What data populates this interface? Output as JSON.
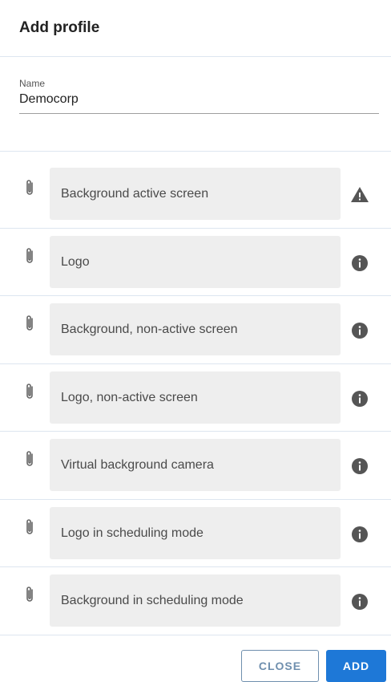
{
  "dialog": {
    "title": "Add profile"
  },
  "name_field": {
    "label": "Name",
    "value": "Democorp"
  },
  "uploads": [
    {
      "label": "Background active screen",
      "status_icon": "warning-icon"
    },
    {
      "label": "Logo",
      "status_icon": "info-icon"
    },
    {
      "label": "Background, non-active screen",
      "status_icon": "info-icon"
    },
    {
      "label": "Logo, non-active screen",
      "status_icon": "info-icon"
    },
    {
      "label": "Virtual background camera",
      "status_icon": "info-icon"
    },
    {
      "label": "Logo in scheduling mode",
      "status_icon": "info-icon"
    },
    {
      "label": "Background in scheduling mode",
      "status_icon": "info-icon"
    }
  ],
  "actions": {
    "close_label": "CLOSE",
    "add_label": "ADD"
  },
  "colors": {
    "accent": "#1e78d7",
    "outline": "#6f8fae",
    "field_bg": "#eeeeee",
    "icon": "#555555"
  }
}
